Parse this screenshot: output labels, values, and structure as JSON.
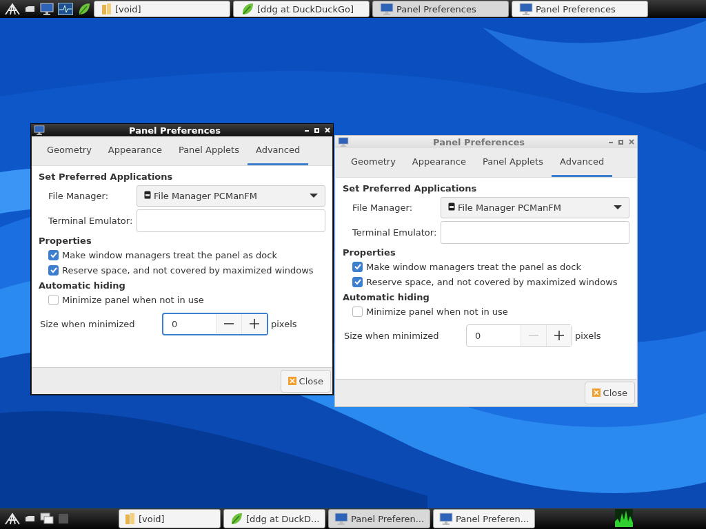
{
  "top_panel": {
    "launchers": [
      {
        "kind": "logo"
      },
      {
        "kind": "drive"
      },
      {
        "kind": "monitor"
      },
      {
        "kind": "graph"
      },
      {
        "kind": "leaf"
      }
    ],
    "tasks": [
      {
        "kind": "folder",
        "label": "[void]",
        "selected": false
      },
      {
        "kind": "leaf",
        "label": "[ddg at DuckDuckGo]",
        "selected": false
      },
      {
        "kind": "monitor",
        "label": "Panel Preferences",
        "selected": true
      },
      {
        "kind": "monitor",
        "label": "Panel Preferences",
        "selected": false
      }
    ]
  },
  "windows": [
    {
      "title": "Panel Preferences",
      "active": true,
      "tabs": [
        {
          "label": "Geometry",
          "selected": false
        },
        {
          "label": "Appearance",
          "selected": false
        },
        {
          "label": "Panel Applets",
          "selected": false
        },
        {
          "label": "Advanced",
          "selected": true
        }
      ],
      "sections": [
        {
          "heading": "Set Preferred Applications",
          "rows": [
            {
              "kind": "combo",
              "label": "File Manager:",
              "value": "File Manager PCManFM"
            },
            {
              "kind": "entry",
              "label": "Terminal Emulator:"
            }
          ]
        },
        {
          "heading": "Properties",
          "rows": [
            {
              "kind": "check",
              "label": "Make window managers treat the panel as dock",
              "checked": true
            },
            {
              "kind": "check",
              "label": "Reserve space, and not covered by maximized windows",
              "checked": true
            }
          ]
        },
        {
          "heading": "Automatic hiding",
          "rows": [
            {
              "kind": "check",
              "label": "Minimize panel when not in use",
              "checked": false
            },
            {
              "kind": "spin",
              "label": "Size when minimized",
              "value": "0",
              "unit": "pixels",
              "focused": true,
              "minus_disabled": false
            }
          ]
        }
      ],
      "close_label": "Close"
    },
    {
      "title": "Panel Preferences",
      "active": false,
      "tabs": [
        {
          "label": "Geometry",
          "selected": false
        },
        {
          "label": "Appearance",
          "selected": false
        },
        {
          "label": "Panel Applets",
          "selected": false
        },
        {
          "label": "Advanced",
          "selected": true
        }
      ],
      "sections": [
        {
          "heading": "Set Preferred Applications",
          "rows": [
            {
              "kind": "combo",
              "label": "File Manager:",
              "value": "File Manager PCManFM"
            },
            {
              "kind": "entry",
              "label": "Terminal Emulator:"
            }
          ]
        },
        {
          "heading": "Properties",
          "rows": [
            {
              "kind": "check",
              "label": "Make window managers treat the panel as dock",
              "checked": true
            },
            {
              "kind": "check",
              "label": "Reserve space, and not covered by maximized windows",
              "checked": true
            }
          ]
        },
        {
          "heading": "Automatic hiding",
          "rows": [
            {
              "kind": "check",
              "label": "Minimize panel when not in use",
              "checked": false
            },
            {
              "kind": "spin",
              "label": "Size when minimized",
              "value": "0",
              "unit": "pixels",
              "focused": false,
              "minus_disabled": true
            }
          ]
        }
      ],
      "close_label": "Close"
    }
  ],
  "bottom_panel": {
    "launchers": [
      {
        "kind": "logo"
      },
      {
        "kind": "drive"
      },
      {
        "kind": "windows"
      },
      {
        "kind": "square"
      }
    ],
    "tasks": [
      {
        "kind": "folder",
        "label": "[void]",
        "selected": false
      },
      {
        "kind": "leaf",
        "label": "[ddg at DuckD...",
        "selected": false
      },
      {
        "kind": "monitor",
        "label": "Panel Preferen...",
        "selected": true
      },
      {
        "kind": "monitor",
        "label": "Panel Preferen...",
        "selected": false
      }
    ]
  }
}
